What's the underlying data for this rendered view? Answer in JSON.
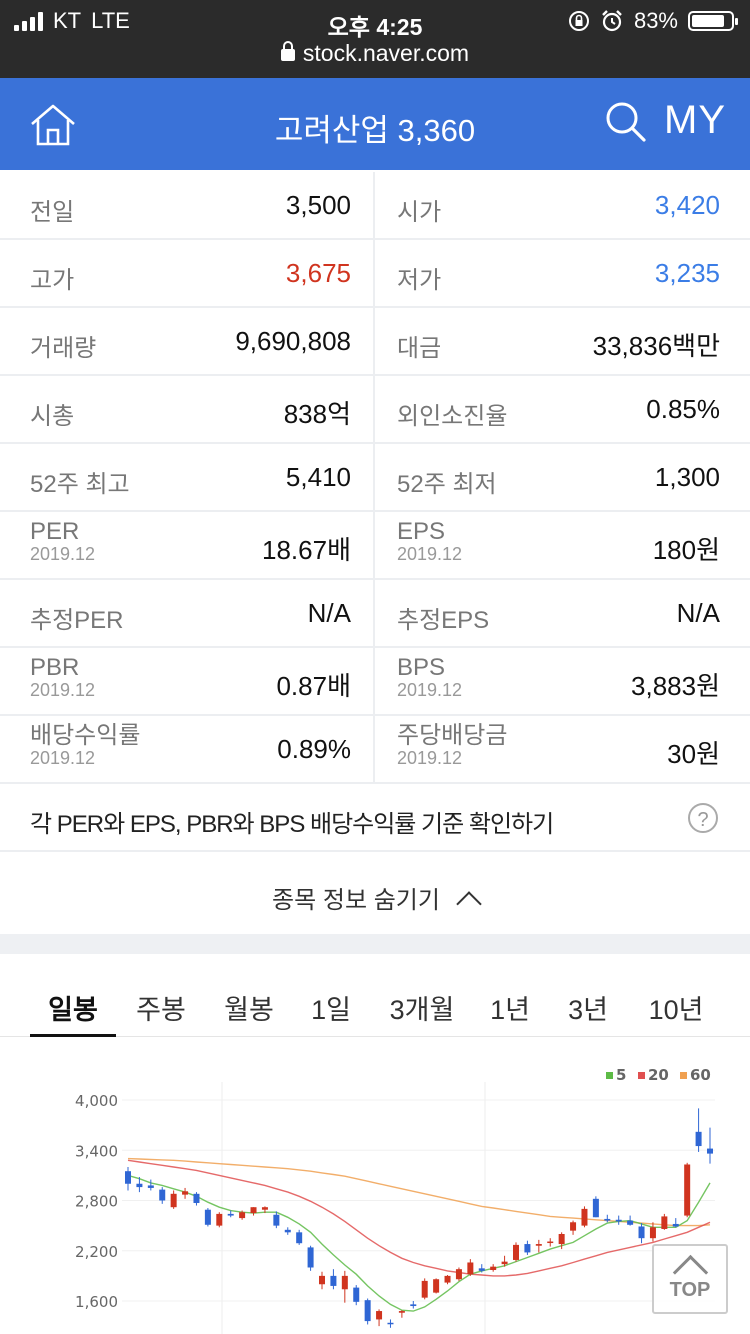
{
  "status_bar": {
    "carrier": "KT",
    "network": "LTE",
    "time": "오후 4:25",
    "battery": "83%",
    "battery_level": 0.83,
    "url": "stock.naver.com"
  },
  "header": {
    "title": "고려산업 3,360",
    "my_label": "MY"
  },
  "stats": [
    {
      "left": {
        "label": "전일",
        "sub": "",
        "value": "3,500",
        "color": "default"
      },
      "right": {
        "label": "시가",
        "sub": "",
        "value": "3,420",
        "color": "blue"
      }
    },
    {
      "left": {
        "label": "고가",
        "sub": "",
        "value": "3,675",
        "color": "red"
      },
      "right": {
        "label": "저가",
        "sub": "",
        "value": "3,235",
        "color": "blue"
      }
    },
    {
      "left": {
        "label": "거래량",
        "sub": "",
        "value": "9,690,808",
        "color": "default"
      },
      "right": {
        "label": "대금",
        "sub": "",
        "value": "33,836백만",
        "color": "default"
      }
    },
    {
      "left": {
        "label": "시총",
        "sub": "",
        "value": "838억",
        "color": "default"
      },
      "right": {
        "label": "외인소진율",
        "sub": "",
        "value": "0.85%",
        "color": "default"
      }
    },
    {
      "left": {
        "label": "52주 최고",
        "sub": "",
        "value": "5,410",
        "color": "default"
      },
      "right": {
        "label": "52주 최저",
        "sub": "",
        "value": "1,300",
        "color": "default"
      }
    },
    {
      "left": {
        "label": "PER",
        "sub": "2019.12",
        "value": "18.67배",
        "color": "default"
      },
      "right": {
        "label": "EPS",
        "sub": "2019.12",
        "value": "180원",
        "color": "default"
      }
    },
    {
      "left": {
        "label": "추정PER",
        "sub": "",
        "value": "N/A",
        "color": "default"
      },
      "right": {
        "label": "추정EPS",
        "sub": "",
        "value": "N/A",
        "color": "default"
      }
    },
    {
      "left": {
        "label": "PBR",
        "sub": "2019.12",
        "value": "0.87배",
        "color": "default"
      },
      "right": {
        "label": "BPS",
        "sub": "2019.12",
        "value": "3,883원",
        "color": "default"
      }
    },
    {
      "left": {
        "label": "배당수익률",
        "sub": "2019.12",
        "value": "0.89%",
        "color": "default"
      },
      "right": {
        "label": "주당배당금",
        "sub": "2019.12",
        "value": "30원",
        "color": "default"
      }
    }
  ],
  "info_link": "각 PER와 EPS, PBR와 BPS 배당수익률 기준 확인하기",
  "help_icon": "?",
  "hide_toggle": "종목 정보 숨기기",
  "tabs": [
    "일봉",
    "주봉",
    "월봉",
    "1일",
    "3개월",
    "1년",
    "3년",
    "10년"
  ],
  "active_tab": 0,
  "top_button": "TOP",
  "chart_data": {
    "type": "candlestick",
    "y_ticks": [
      "4,000",
      "3,400",
      "2,800",
      "2,200",
      "1,600"
    ],
    "y_tick_values": [
      4000,
      3400,
      2800,
      2200,
      1600
    ],
    "ylim": [
      1250,
      4250
    ],
    "legend": [
      {
        "name": "5",
        "color": "#5dbb46"
      },
      {
        "name": "20",
        "color": "#e05050"
      },
      {
        "name": "60",
        "color": "#f0a050"
      }
    ],
    "up_color": "#d0341f",
    "down_color": "#2f66d4",
    "candles": [
      {
        "o": 3150,
        "h": 3200,
        "l": 2920,
        "c": 3000
      },
      {
        "o": 3000,
        "h": 3080,
        "l": 2900,
        "c": 2960
      },
      {
        "o": 2980,
        "h": 3050,
        "l": 2920,
        "c": 2950
      },
      {
        "o": 2930,
        "h": 2960,
        "l": 2760,
        "c": 2800
      },
      {
        "o": 2720,
        "h": 2920,
        "l": 2700,
        "c": 2880
      },
      {
        "o": 2870,
        "h": 2950,
        "l": 2820,
        "c": 2910
      },
      {
        "o": 2880,
        "h": 2900,
        "l": 2740,
        "c": 2770
      },
      {
        "o": 2690,
        "h": 2710,
        "l": 2490,
        "c": 2510
      },
      {
        "o": 2500,
        "h": 2660,
        "l": 2480,
        "c": 2640
      },
      {
        "o": 2640,
        "h": 2680,
        "l": 2600,
        "c": 2620
      },
      {
        "o": 2590,
        "h": 2680,
        "l": 2570,
        "c": 2660
      },
      {
        "o": 2650,
        "h": 2720,
        "l": 2620,
        "c": 2720
      },
      {
        "o": 2690,
        "h": 2730,
        "l": 2650,
        "c": 2720
      },
      {
        "o": 2630,
        "h": 2670,
        "l": 2470,
        "c": 2500
      },
      {
        "o": 2450,
        "h": 2480,
        "l": 2390,
        "c": 2420
      },
      {
        "o": 2420,
        "h": 2450,
        "l": 2270,
        "c": 2290
      },
      {
        "o": 2240,
        "h": 2260,
        "l": 1960,
        "c": 2000
      },
      {
        "o": 1800,
        "h": 1950,
        "l": 1740,
        "c": 1900
      },
      {
        "o": 1900,
        "h": 1980,
        "l": 1740,
        "c": 1780
      },
      {
        "o": 1740,
        "h": 1960,
        "l": 1580,
        "c": 1900
      },
      {
        "o": 1760,
        "h": 1790,
        "l": 1550,
        "c": 1590
      },
      {
        "o": 1610,
        "h": 1630,
        "l": 1320,
        "c": 1360
      },
      {
        "o": 1380,
        "h": 1500,
        "l": 1300,
        "c": 1480
      },
      {
        "o": 1340,
        "h": 1380,
        "l": 1280,
        "c": 1330
      },
      {
        "o": 1460,
        "h": 1490,
        "l": 1400,
        "c": 1480
      },
      {
        "o": 1560,
        "h": 1600,
        "l": 1510,
        "c": 1540
      },
      {
        "o": 1640,
        "h": 1870,
        "l": 1620,
        "c": 1840
      },
      {
        "o": 1700,
        "h": 1870,
        "l": 1690,
        "c": 1860
      },
      {
        "o": 1820,
        "h": 1910,
        "l": 1800,
        "c": 1900
      },
      {
        "o": 1860,
        "h": 2000,
        "l": 1840,
        "c": 1980
      },
      {
        "o": 1920,
        "h": 2100,
        "l": 1900,
        "c": 2060
      },
      {
        "o": 1990,
        "h": 2040,
        "l": 1940,
        "c": 1960
      },
      {
        "o": 1970,
        "h": 2040,
        "l": 1950,
        "c": 2010
      },
      {
        "o": 2040,
        "h": 2140,
        "l": 2010,
        "c": 2070
      },
      {
        "o": 2090,
        "h": 2300,
        "l": 2070,
        "c": 2270
      },
      {
        "o": 2280,
        "h": 2320,
        "l": 2150,
        "c": 2180
      },
      {
        "o": 2260,
        "h": 2330,
        "l": 2180,
        "c": 2280
      },
      {
        "o": 2300,
        "h": 2350,
        "l": 2250,
        "c": 2310
      },
      {
        "o": 2280,
        "h": 2420,
        "l": 2220,
        "c": 2400
      },
      {
        "o": 2440,
        "h": 2560,
        "l": 2390,
        "c": 2540
      },
      {
        "o": 2500,
        "h": 2730,
        "l": 2480,
        "c": 2700
      },
      {
        "o": 2820,
        "h": 2850,
        "l": 2600,
        "c": 2600
      },
      {
        "o": 2580,
        "h": 2630,
        "l": 2540,
        "c": 2560
      },
      {
        "o": 2570,
        "h": 2620,
        "l": 2510,
        "c": 2550
      },
      {
        "o": 2560,
        "h": 2620,
        "l": 2500,
        "c": 2510
      },
      {
        "o": 2490,
        "h": 2530,
        "l": 2290,
        "c": 2350
      },
      {
        "o": 2350,
        "h": 2540,
        "l": 2310,
        "c": 2480
      },
      {
        "o": 2460,
        "h": 2640,
        "l": 2450,
        "c": 2610
      },
      {
        "o": 2520,
        "h": 2590,
        "l": 2480,
        "c": 2490
      },
      {
        "o": 2620,
        "h": 3250,
        "l": 2600,
        "c": 3230
      },
      {
        "o": 3620,
        "h": 3900,
        "l": 3380,
        "c": 3450
      },
      {
        "o": 3420,
        "h": 3670,
        "l": 3240,
        "c": 3360
      }
    ],
    "ma5": [
      3100,
      3060,
      3010,
      2980,
      2940,
      2900,
      2850,
      2780,
      2720,
      2680,
      2660,
      2650,
      2660,
      2660,
      2600,
      2520,
      2420,
      2280,
      2150,
      2030,
      1920,
      1780,
      1660,
      1560,
      1490,
      1480,
      1530,
      1620,
      1720,
      1830,
      1920,
      1960,
      1990,
      2020,
      2070,
      2120,
      2170,
      2220,
      2260,
      2300,
      2380,
      2460,
      2530,
      2550,
      2560,
      2520,
      2480,
      2480,
      2480,
      2560,
      2780,
      3010
    ],
    "ma20": [
      3280,
      3260,
      3240,
      3220,
      3200,
      3180,
      3160,
      3130,
      3100,
      3070,
      3040,
      3010,
      2980,
      2940,
      2900,
      2850,
      2790,
      2720,
      2640,
      2550,
      2450,
      2350,
      2260,
      2180,
      2110,
      2060,
      2020,
      1990,
      1960,
      1940,
      1920,
      1910,
      1900,
      1900,
      1910,
      1930,
      1960,
      1990,
      2020,
      2060,
      2100,
      2140,
      2180,
      2210,
      2240,
      2270,
      2300,
      2340,
      2380,
      2420,
      2480,
      2540
    ],
    "ma60": [
      3300,
      3295,
      3290,
      3285,
      3280,
      3270,
      3260,
      3250,
      3240,
      3230,
      3220,
      3210,
      3200,
      3190,
      3180,
      3165,
      3150,
      3130,
      3110,
      3090,
      3060,
      3030,
      3000,
      2970,
      2940,
      2910,
      2880,
      2850,
      2820,
      2790,
      2760,
      2730,
      2710,
      2690,
      2670,
      2650,
      2630,
      2610,
      2600,
      2590,
      2580,
      2570,
      2560,
      2550,
      2540,
      2530,
      2520,
      2510,
      2500,
      2500,
      2500,
      2510
    ]
  }
}
